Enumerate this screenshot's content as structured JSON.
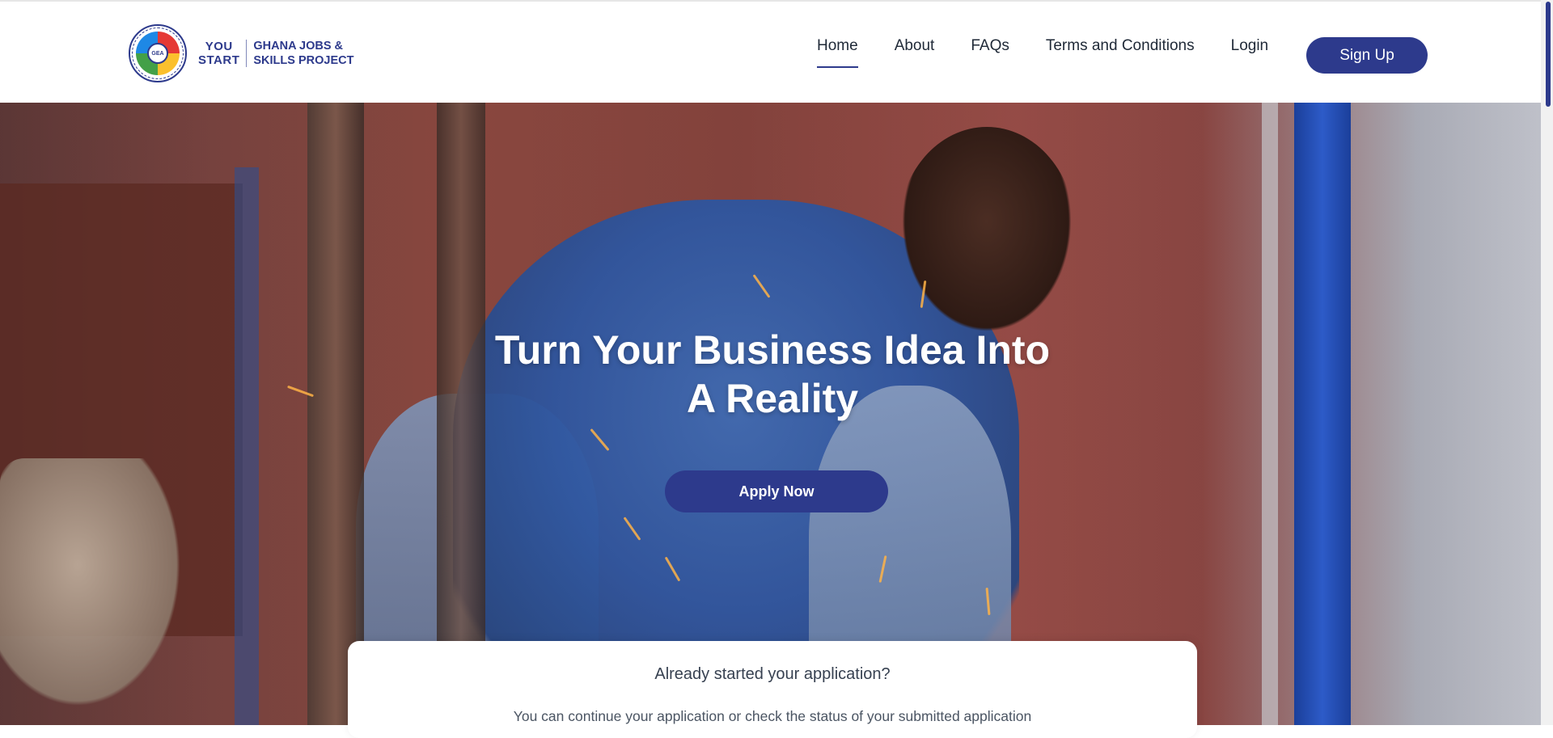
{
  "brand": {
    "seal_text": "GEA",
    "you": "YOU",
    "start": "START",
    "name_line1": "GHANA JOBS &",
    "name_line2": "SKILLS PROJECT"
  },
  "nav": {
    "items": [
      {
        "label": "Home",
        "active": true
      },
      {
        "label": "About",
        "active": false
      },
      {
        "label": "FAQs",
        "active": false
      },
      {
        "label": "Terms and Conditions",
        "active": false
      },
      {
        "label": "Login",
        "active": false
      }
    ],
    "signup_label": "Sign Up"
  },
  "hero": {
    "title_line1": "Turn Your Business Idea Into",
    "title_line2": "A Reality",
    "cta_label": "Apply Now"
  },
  "card": {
    "title": "Already started your application?",
    "subtitle": "You can continue your application or check the status of your submitted application"
  },
  "colors": {
    "primary": "#2d3a8c",
    "text": "#1f2937"
  }
}
